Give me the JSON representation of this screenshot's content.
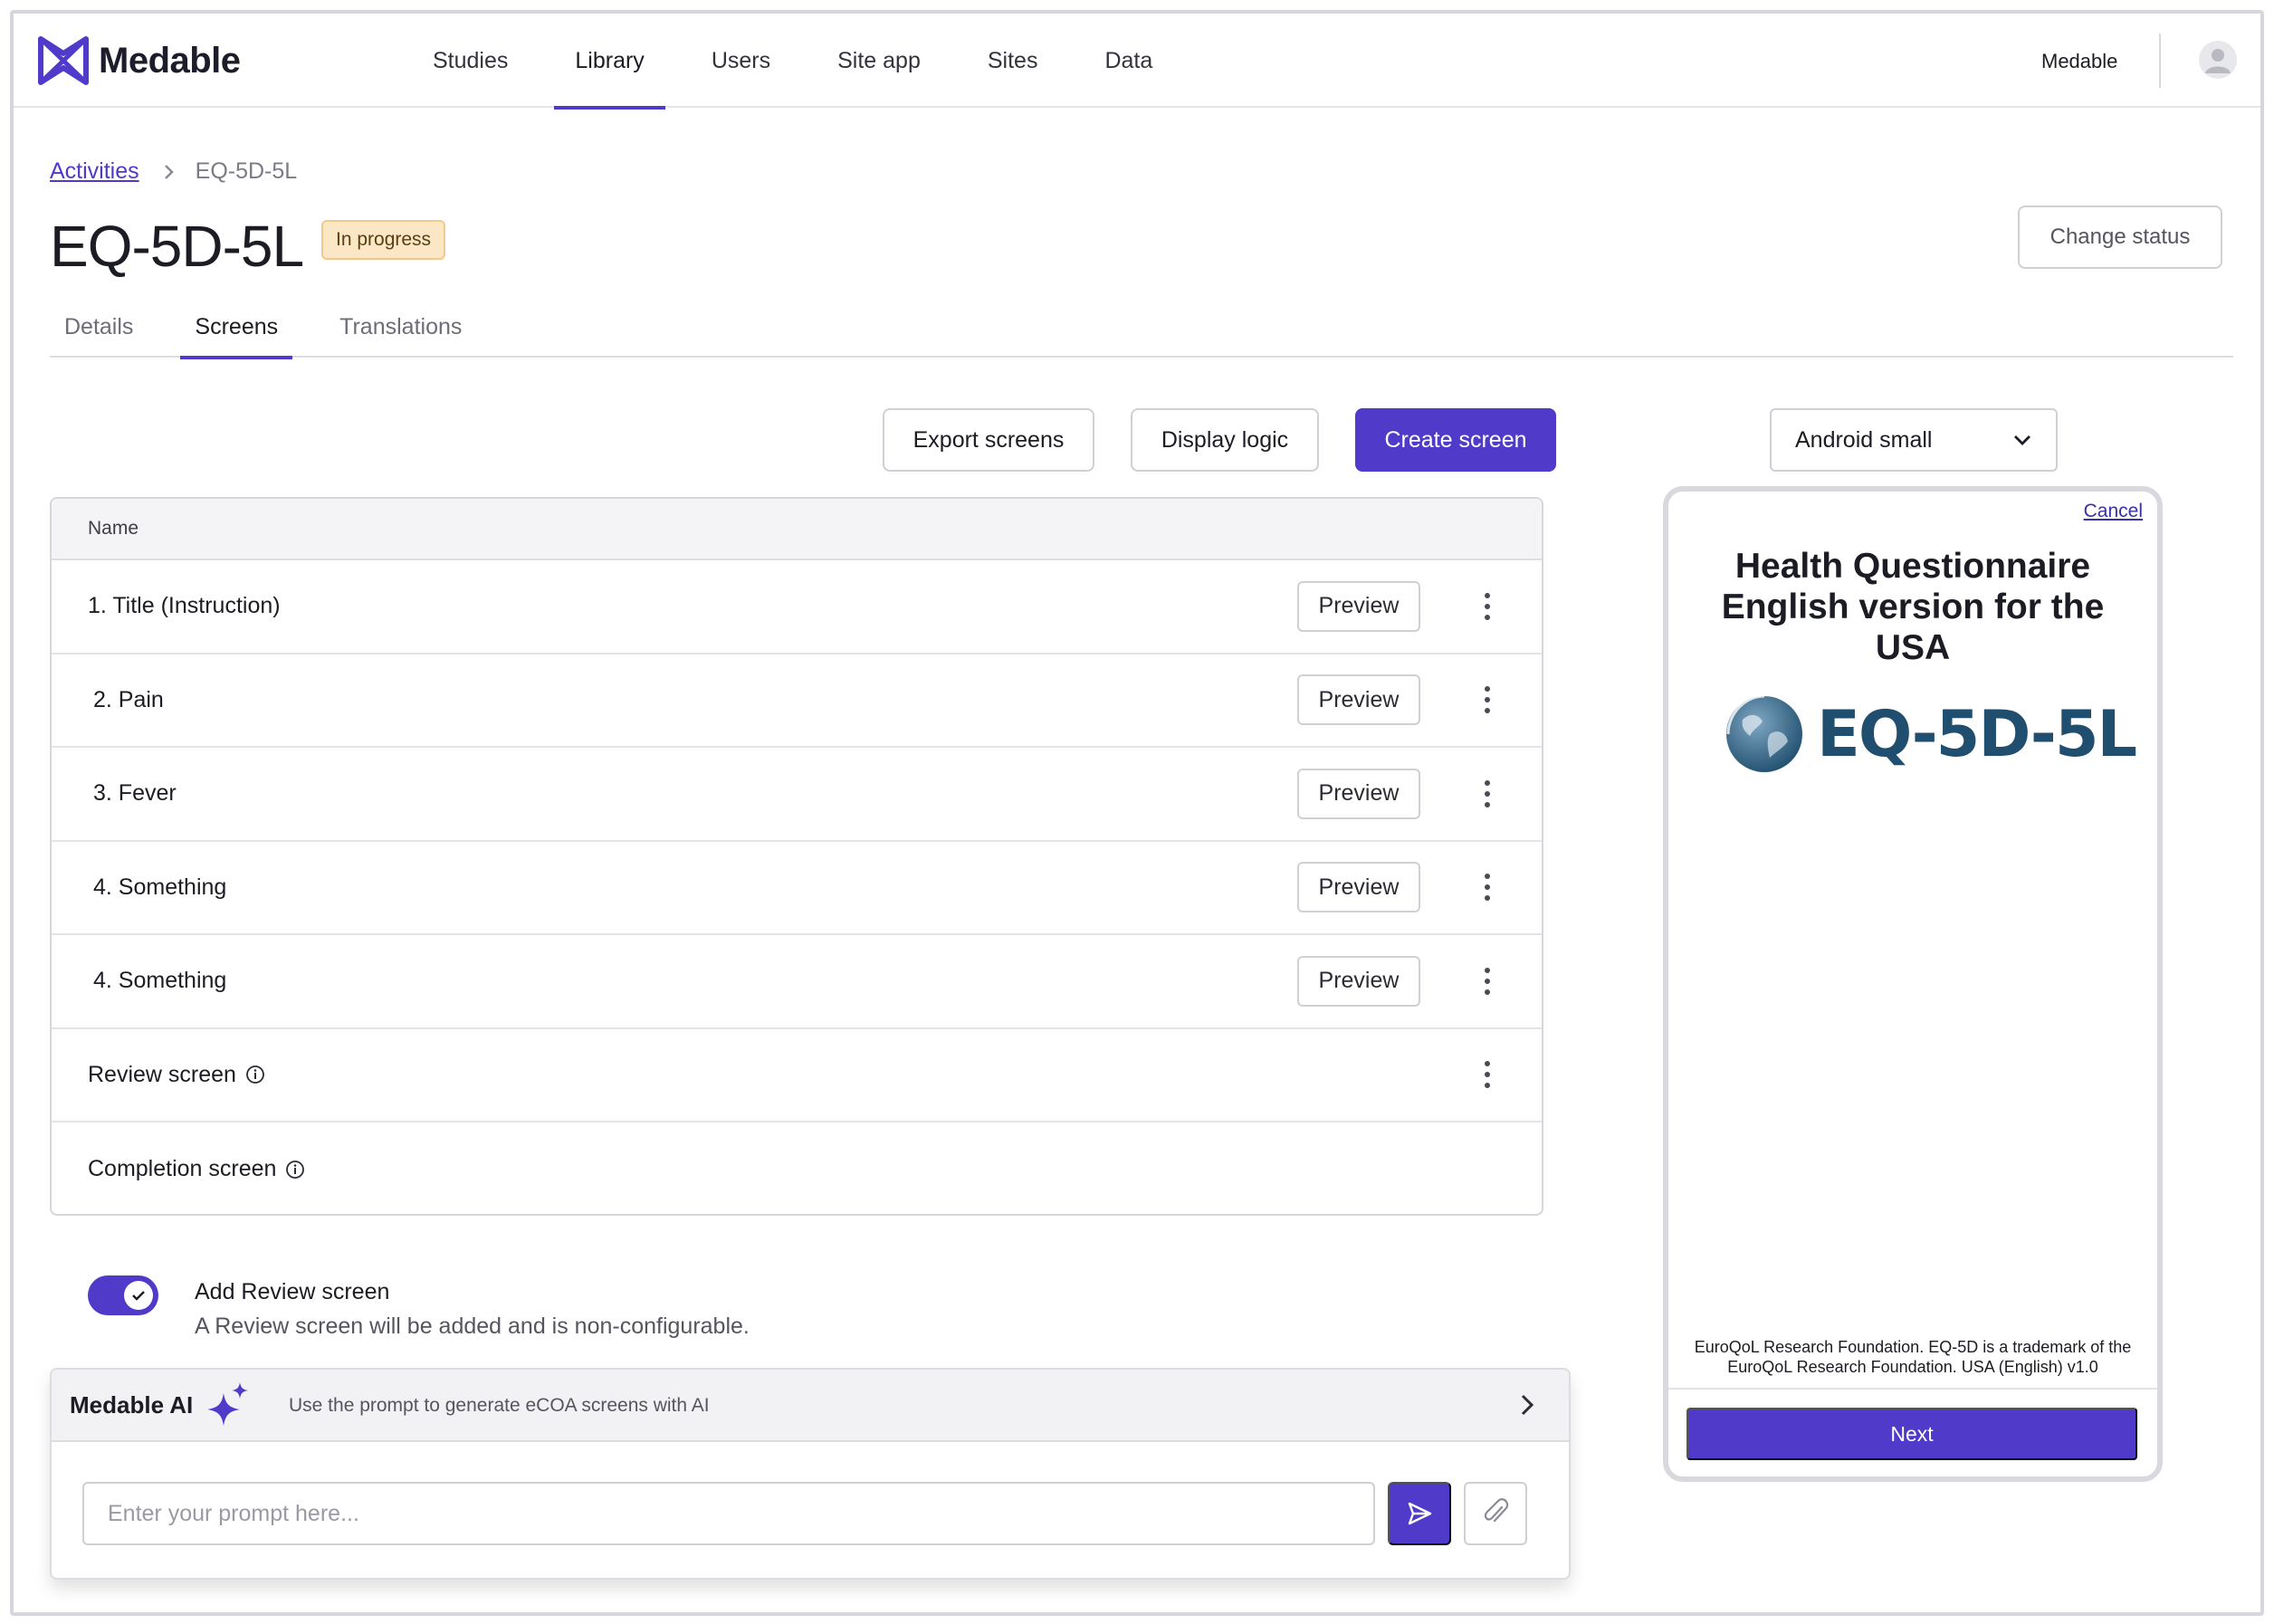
{
  "app": {
    "brand": "Medable",
    "org_name": "Medable",
    "accent_color": "#4f3ac9"
  },
  "nav": {
    "items": [
      {
        "label": "Studies"
      },
      {
        "label": "Library"
      },
      {
        "label": "Users"
      },
      {
        "label": "Site app"
      },
      {
        "label": "Sites"
      },
      {
        "label": "Data"
      }
    ],
    "active": "Library"
  },
  "breadcrumb": {
    "parent": "Activities",
    "current": "EQ-5D-5L"
  },
  "page": {
    "title": "EQ-5D-5L",
    "status": "In progress",
    "change_status_label": "Change status"
  },
  "tabs": {
    "items": [
      {
        "label": "Details"
      },
      {
        "label": "Screens"
      },
      {
        "label": "Translations"
      }
    ],
    "active": "Screens"
  },
  "toolbar": {
    "export_label": "Export screens",
    "display_logic_label": "Display logic",
    "create_label": "Create screen"
  },
  "device_select": {
    "value": "Android small"
  },
  "table": {
    "header": "Name",
    "preview_label": "Preview",
    "rows": [
      {
        "name": "1. Title (Instruction)"
      },
      {
        "name": "2. Pain"
      },
      {
        "name": "3. Fever"
      },
      {
        "name": "4. Something"
      },
      {
        "name": "4. Something"
      },
      {
        "name": "Review screen"
      },
      {
        "name": "Completion screen"
      }
    ]
  },
  "review_toggle": {
    "enabled": true,
    "label": "Add Review screen",
    "description": "A Review screen will be added and is non-configurable."
  },
  "ai": {
    "title": "Medable AI",
    "subtitle": "Use the prompt to generate eCOA screens with AI",
    "placeholder": "Enter your prompt here..."
  },
  "preview": {
    "cancel_label": "Cancel",
    "title": "Health Questionnaire English version for the USA",
    "logo_text": "EQ-5D-5L",
    "footer": "EuroQoL Research Foundation. EQ-5D is a trademark of the EuroQoL Research Foundation. USA (English) v1.0",
    "next_label": "Next"
  }
}
